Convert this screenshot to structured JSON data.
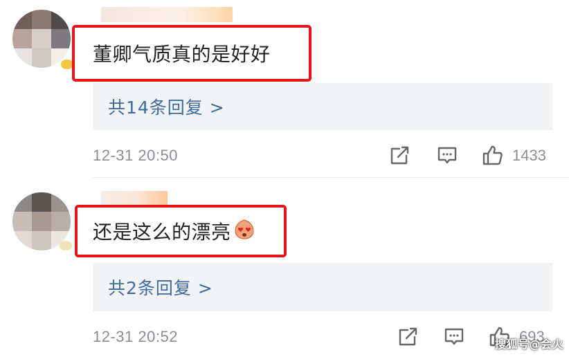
{
  "comments": [
    {
      "text": "董卿气质真的是好好",
      "replies_label": "共14条回复 >",
      "timestamp": "12-31 20:50",
      "likes": "1433"
    },
    {
      "text": "还是这么的漂亮",
      "replies_label": "共2条回复 >",
      "timestamp": "12-31 20:52",
      "likes": "693"
    }
  ],
  "icons": {
    "share": "share-icon",
    "comment": "comment-icon",
    "like": "thumbs-up-icon",
    "emoji": "heart-eyes-emoji"
  },
  "colors": {
    "highlight_border": "#e3161d",
    "link_blue": "#3e6b9f",
    "meta_gray": "#8a8d93",
    "reply_bg": "#f2f3f5"
  },
  "watermark": "搜狐号@会火"
}
